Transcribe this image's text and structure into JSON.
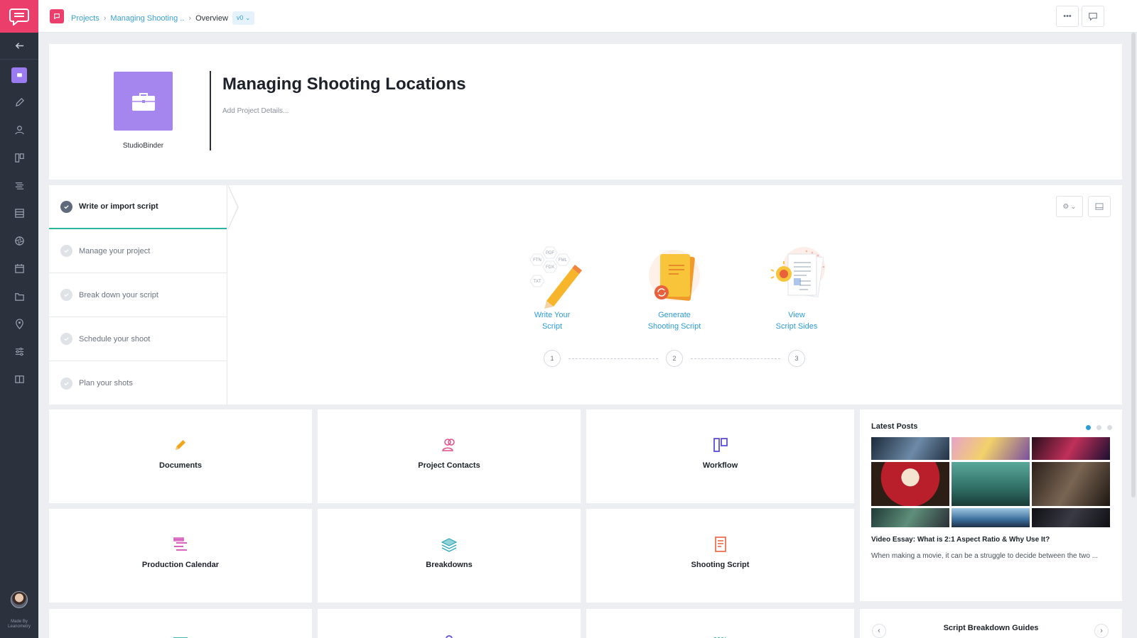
{
  "breadcrumb": {
    "projects": "Projects",
    "project": "Managing Shooting ..",
    "current": "Overview",
    "version": "v0"
  },
  "header": {
    "title": "Managing Shooting Locations",
    "details_placeholder": "Add Project Details...",
    "company": "StudioBinder"
  },
  "steps": [
    {
      "label": "Write or import script",
      "done": true,
      "active": true
    },
    {
      "label": "Manage your project",
      "done": false
    },
    {
      "label": "Break down your script",
      "done": false
    },
    {
      "label": "Schedule your shoot",
      "done": false
    },
    {
      "label": "Plan your shots",
      "done": false
    }
  ],
  "actions": [
    {
      "line1": "Write Your",
      "line2": "Script",
      "step": "1"
    },
    {
      "line1": "Generate",
      "line2": "Shooting Script",
      "step": "2"
    },
    {
      "line1": "View",
      "line2": "Script Sides",
      "step": "3"
    }
  ],
  "script_formats": [
    "PDF",
    "FTN",
    "FDX",
    "FML",
    "TXT"
  ],
  "tiles": [
    {
      "label": "Documents",
      "icon": "pencil-icon",
      "color": "#f2a51a"
    },
    {
      "label": "Project Contacts",
      "icon": "contacts-icon",
      "color": "#e0508a"
    },
    {
      "label": "Workflow",
      "icon": "workflow-icon",
      "color": "#5b4fd6"
    },
    {
      "label": "Production Calendar",
      "icon": "calendar-icon",
      "color": "#d44fb8"
    },
    {
      "label": "Breakdowns",
      "icon": "layers-icon",
      "color": "#2fa7b5"
    },
    {
      "label": "Shooting Script",
      "icon": "script-icon",
      "color": "#e8603c"
    }
  ],
  "posts": {
    "heading": "Latest Posts",
    "title": "Video Essay: What is 2:1 Aspect Ratio & Why Use It?",
    "excerpt": "When making a movie, it can be a struggle to decide between the two ...",
    "active_page": 1,
    "page_count": 3
  },
  "guides": {
    "heading": "Script Breakdown Guides"
  },
  "footer": {
    "made_by_line1": "Made By",
    "made_by_line2": "Leanometry"
  },
  "colors": {
    "brand": "#ec3e6a",
    "sidebar": "#2b313d",
    "link": "#2d9cd6",
    "project_logo": "#a586ef",
    "step_active_underline": "#2bb5a0"
  }
}
